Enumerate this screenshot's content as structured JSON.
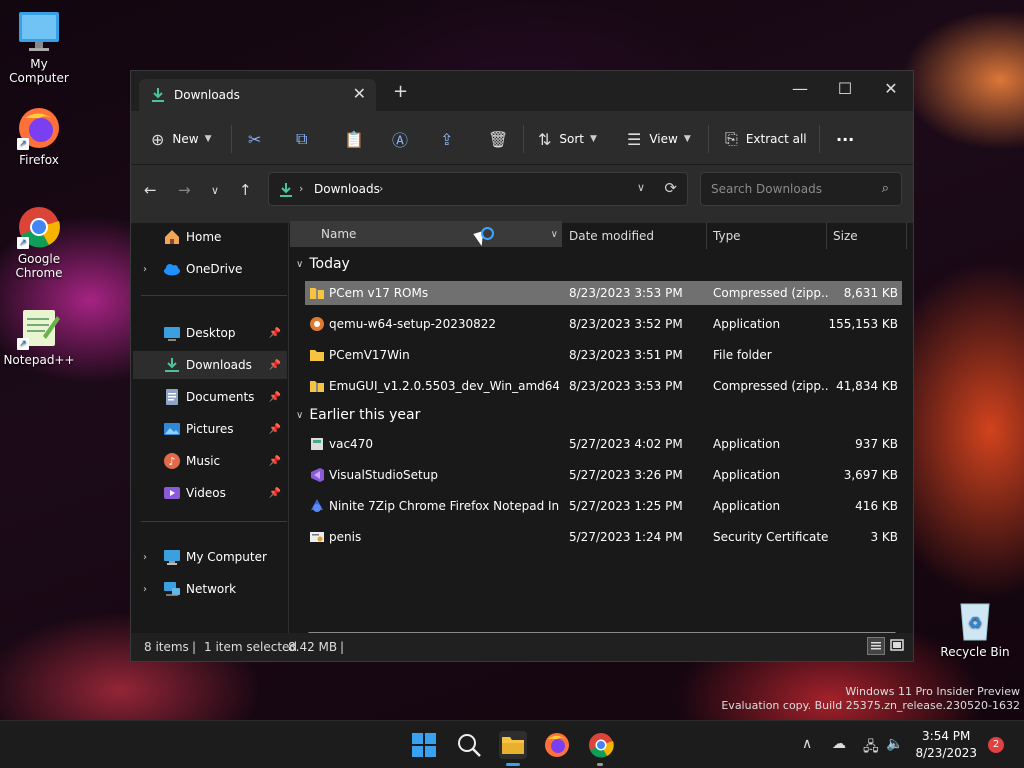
{
  "desktop": {
    "icons": [
      {
        "label": "My Computer"
      },
      {
        "label": "Firefox"
      },
      {
        "label": "Google Chrome"
      },
      {
        "label": "Notepad++"
      },
      {
        "label": "Recycle Bin"
      }
    ],
    "watermark": {
      "line1": "Windows 11 Pro Insider Preview",
      "line2": "Evaluation copy. Build 25375.zn_release.230520-1632"
    }
  },
  "window": {
    "tab_title": "Downloads",
    "toolbar": {
      "new_label": "New",
      "sort_label": "Sort",
      "view_label": "View",
      "extract_label": "Extract all",
      "more_label": "···"
    },
    "address": {
      "location": "Downloads",
      "search_placeholder": "Search Downloads"
    },
    "nav": {
      "home": "Home",
      "onedrive": "OneDrive",
      "desktop": "Desktop",
      "downloads": "Downloads",
      "documents": "Documents",
      "pictures": "Pictures",
      "music": "Music",
      "videos": "Videos",
      "mycomputer": "My Computer",
      "network": "Network"
    },
    "columns": {
      "name": "Name",
      "date": "Date modified",
      "type": "Type",
      "size": "Size"
    },
    "groups": {
      "today": "Today",
      "earlier": "Earlier this year"
    },
    "files": [
      {
        "name": "PCem v17 ROMs",
        "date": "8/23/2023 3:53 PM",
        "type": "Compressed (zipp...",
        "size": "8,631 KB"
      },
      {
        "name": "qemu-w64-setup-20230822",
        "date": "8/23/2023 3:52 PM",
        "type": "Application",
        "size": "155,153 KB"
      },
      {
        "name": "PCemV17Win",
        "date": "8/23/2023 3:51 PM",
        "type": "File folder",
        "size": ""
      },
      {
        "name": "EmuGUI_v1.2.0.5503_dev_Win_amd64",
        "date": "8/23/2023 3:53 PM",
        "type": "Compressed (zipp...",
        "size": "41,834 KB"
      },
      {
        "name": "vac470",
        "date": "5/27/2023 4:02 PM",
        "type": "Application",
        "size": "937 KB"
      },
      {
        "name": "VisualStudioSetup",
        "date": "5/27/2023 3:26 PM",
        "type": "Application",
        "size": "3,697 KB"
      },
      {
        "name": "Ninite 7Zip Chrome Firefox Notepad Inst...",
        "date": "5/27/2023 1:25 PM",
        "type": "Application",
        "size": "416 KB"
      },
      {
        "name": "penis",
        "date": "5/27/2023 1:24 PM",
        "type": "Security Certificate",
        "size": "3 KB"
      }
    ],
    "status": {
      "items": "8 items",
      "selected": "1 item selected",
      "size": "8.42 MB"
    }
  },
  "taskbar": {
    "time": "3:54 PM",
    "date": "8/23/2023",
    "notifications": "2"
  },
  "colors": {
    "accent": "#3ea5ff",
    "folder": "#f6c343",
    "selection": "#707070"
  }
}
